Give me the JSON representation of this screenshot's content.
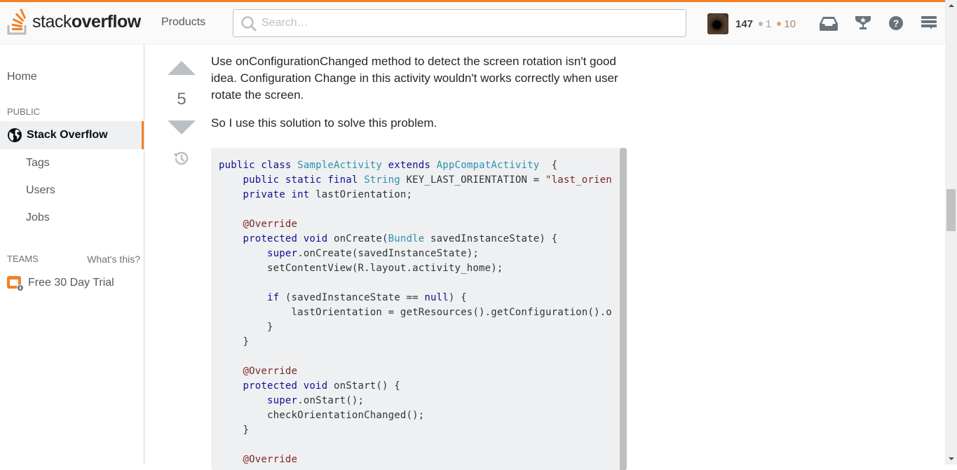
{
  "header": {
    "logo": {
      "light": "stack",
      "bold": "overflow"
    },
    "products_label": "Products",
    "search": {
      "placeholder": "Search…",
      "value": ""
    },
    "user": {
      "reputation": "147",
      "silver_badges": "1",
      "bronze_badges": "10"
    },
    "icons": [
      "inbox-icon",
      "achievements-icon",
      "help-icon",
      "site-switcher-icon"
    ],
    "accent_color": "#f48024"
  },
  "sidebar": {
    "home": "Home",
    "public_heading": "PUBLIC",
    "stack_overflow": "Stack Overflow",
    "items": [
      {
        "label": "Tags"
      },
      {
        "label": "Users"
      },
      {
        "label": "Jobs"
      }
    ],
    "teams_heading": "TEAMS",
    "whats_this": "What's this?",
    "free_trial": "Free 30 Day Trial"
  },
  "answer": {
    "vote_count": "5",
    "paragraphs": [
      "Use onConfigurationChanged method to detect the screen rotation isn't good idea. Configuration Change in this activity wouldn't works correctly when user rotate the screen.",
      "So I use this solution to solve this problem."
    ],
    "code_lines": [
      [
        [
          "kw",
          "public class "
        ],
        [
          "ty",
          "SampleActivity"
        ],
        [
          "kw",
          " extends "
        ],
        [
          "ty",
          "AppCompatActivity"
        ],
        [
          "",
          "  {"
        ]
      ],
      [
        [
          "",
          "    "
        ],
        [
          "kw",
          "public static final "
        ],
        [
          "ty",
          "String"
        ],
        [
          "",
          " KEY_LAST_ORIENTATION = "
        ],
        [
          "st",
          "\"last_orientation\""
        ],
        [
          "",
          ";"
        ]
      ],
      [
        [
          "",
          "    "
        ],
        [
          "kw",
          "private int"
        ],
        [
          "",
          " lastOrientation;"
        ]
      ],
      [
        [
          "",
          ""
        ]
      ],
      [
        [
          "",
          "    "
        ],
        [
          "an",
          "@Override"
        ]
      ],
      [
        [
          "",
          "    "
        ],
        [
          "kw",
          "protected void"
        ],
        [
          "",
          " onCreate("
        ],
        [
          "ty",
          "Bundle"
        ],
        [
          "",
          " savedInstanceState) {"
        ]
      ],
      [
        [
          "",
          "        "
        ],
        [
          "kw",
          "super"
        ],
        [
          "",
          ".onCreate(savedInstanceState);"
        ]
      ],
      [
        [
          "",
          "        setContentView(R.layout.activity_home);"
        ]
      ],
      [
        [
          "",
          ""
        ]
      ],
      [
        [
          "",
          "        "
        ],
        [
          "kw",
          "if"
        ],
        [
          "",
          " (savedInstanceState == "
        ],
        [
          "kw",
          "null"
        ],
        [
          "",
          ") {"
        ]
      ],
      [
        [
          "",
          "            lastOrientation = getResources().getConfiguration().orientation;"
        ]
      ],
      [
        [
          "",
          "        }"
        ]
      ],
      [
        [
          "",
          "    }"
        ]
      ],
      [
        [
          "",
          ""
        ]
      ],
      [
        [
          "",
          "    "
        ],
        [
          "an",
          "@Override"
        ]
      ],
      [
        [
          "",
          "    "
        ],
        [
          "kw",
          "protected void"
        ],
        [
          "",
          " onStart() {"
        ]
      ],
      [
        [
          "",
          "        "
        ],
        [
          "kw",
          "super"
        ],
        [
          "",
          ".onStart();"
        ]
      ],
      [
        [
          "",
          "        checkOrientationChanged();"
        ]
      ],
      [
        [
          "",
          "    }"
        ]
      ],
      [
        [
          "",
          ""
        ]
      ],
      [
        [
          "",
          "    "
        ],
        [
          "an",
          "@Override"
        ]
      ]
    ]
  }
}
